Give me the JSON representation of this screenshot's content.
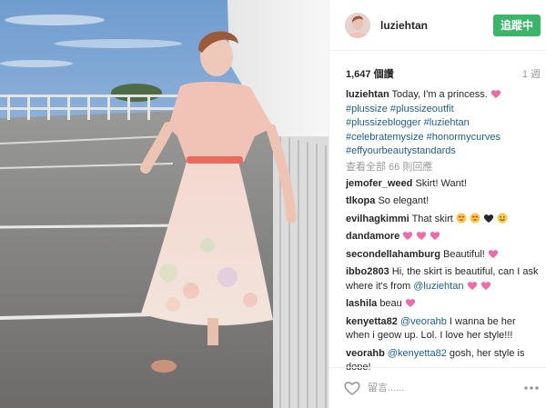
{
  "post": {
    "username": "luziehtan",
    "follow_label": "追蹤中",
    "likes": "1,647 個讚",
    "age": "1 週",
    "caption": {
      "username": "luziehtan",
      "text": "Today, I'm a princess.",
      "hashtags": [
        "#plussize",
        "#plussizeoutfit",
        "#plussizeblogger",
        "#luziehtan",
        "#celebratemysize",
        "#honormycurves",
        "#effyourbeautystandards"
      ]
    },
    "view_all": "查看全部 66 則回應",
    "comments": [
      {
        "user": "jemofer_weed",
        "text": "Skirt! Want!",
        "mention": "",
        "after": ""
      },
      {
        "user": "tlkopa",
        "text": "So elegant!",
        "mention": "",
        "after": ""
      },
      {
        "user": "evilhagkimmi",
        "text": "That skirt",
        "mention": "",
        "after": ""
      },
      {
        "user": "dandamore",
        "text": "",
        "mention": "",
        "after": ""
      },
      {
        "user": "secondellahamburg",
        "text": "Beautiful!",
        "mention": "",
        "after": ""
      },
      {
        "user": "ibbo2803",
        "text": "Hi, the skirt is beautiful, can I ask where it's from",
        "mention": "@luziehtan",
        "after": ""
      },
      {
        "user": "lashila",
        "text": "beau",
        "mention": "",
        "after": ""
      },
      {
        "user": "kenyetta82",
        "text": "",
        "mention": "@veorahb",
        "after": "I wanna be her when i geow up. Lol. I love her style!!!"
      },
      {
        "user": "veorahb",
        "text": "",
        "mention": "@kenyetta82",
        "after": "gosh, her style is dope!"
      }
    ],
    "comment_placeholder": "留言......",
    "icons": {
      "like": "heart-outline-icon",
      "more": "more-options-icon",
      "emoji_heart": "sparkling-heart-icon",
      "emoji_face": "heart-eyes-face-icon",
      "emoji_black_heart": "black-heart-icon",
      "emoji_smile": "smiling-face-icon"
    },
    "colors": {
      "follow_button": "#3cb56a",
      "link": "#1f5d8c",
      "emoji_pink": "#f06aa8"
    }
  }
}
